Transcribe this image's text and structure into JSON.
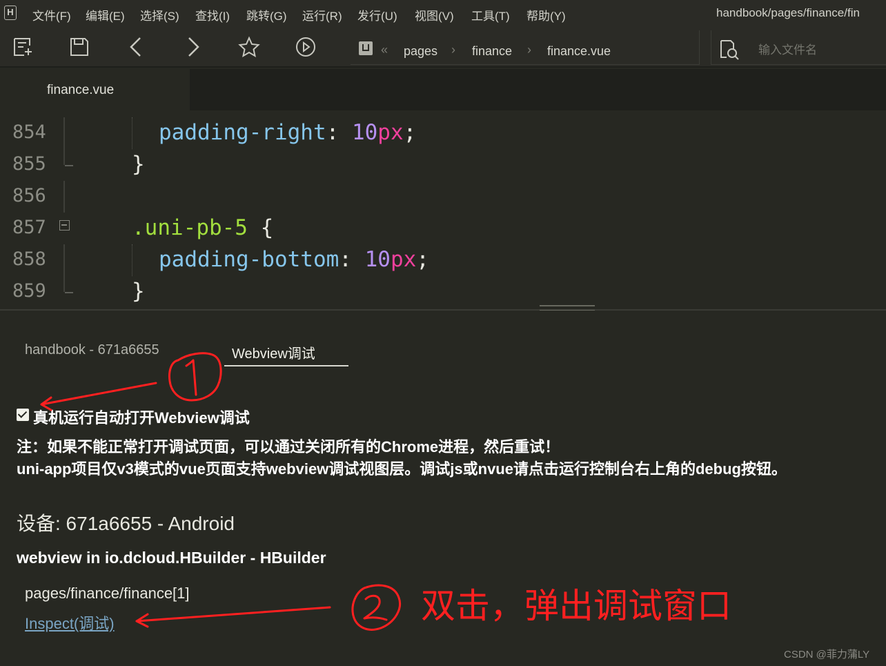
{
  "menubar": {
    "logo": "H",
    "items": [
      "文件(F)",
      "编辑(E)",
      "选择(S)",
      "查找(I)",
      "跳转(G)",
      "运行(R)",
      "发行(U)",
      "视图(V)",
      "工具(T)",
      "帮助(Y)"
    ],
    "title_path": "handbook/pages/finance/fin"
  },
  "toolbar": {
    "icons": [
      "new-file-icon",
      "save-icon",
      "back-icon",
      "forward-icon",
      "star-icon",
      "run-icon"
    ],
    "breadcrumb": [
      "pages",
      "finance",
      "finance.vue"
    ],
    "search_placeholder": "输入文件名"
  },
  "editor": {
    "tab": "finance.vue",
    "lines": [
      {
        "num": "854",
        "tokens": [
          [
            "prop",
            "padding-right"
          ],
          [
            "punc",
            ": "
          ],
          [
            "num",
            "10"
          ],
          [
            "unit",
            "px"
          ],
          [
            "punc",
            ";"
          ]
        ]
      },
      {
        "num": "855",
        "tokens": [
          [
            "punc",
            "}"
          ]
        ]
      },
      {
        "num": "856",
        "tokens": []
      },
      {
        "num": "857",
        "tokens": [
          [
            "sel",
            ".uni-pb-5"
          ],
          [
            "punc",
            " {"
          ]
        ]
      },
      {
        "num": "858",
        "tokens": [
          [
            "prop",
            "padding-bottom"
          ],
          [
            "punc",
            ": "
          ],
          [
            "num",
            "10"
          ],
          [
            "unit",
            "px"
          ],
          [
            "punc",
            ";"
          ]
        ]
      },
      {
        "num": "859",
        "tokens": [
          [
            "punc",
            "}"
          ]
        ]
      }
    ]
  },
  "panel": {
    "tabs": [
      "handbook - 671a6655",
      "Webview调试"
    ],
    "checkbox_label": "真机运行自动打开Webview调试",
    "checkbox_checked": true,
    "note_line1": "注：如果不能正常打开调试页面，可以通过关闭所有的Chrome进程，然后重试！",
    "note_line2": "uni-app项目仅v3模式的vue页面支持webview调试视图层。调试js或nvue请点击运行控制台右上角的debug按钮。",
    "device": "设备: 671a6655 - Android",
    "webview_title": "webview in io.dcloud.HBuilder - HBuilder",
    "page_path": "pages/finance/finance[1]",
    "inspect_link": "Inspect(调试)"
  },
  "annotations": {
    "caption": "双击，弹出调试窗口",
    "color": "#ff2020"
  },
  "watermark": "CSDN @菲力蒲LY"
}
